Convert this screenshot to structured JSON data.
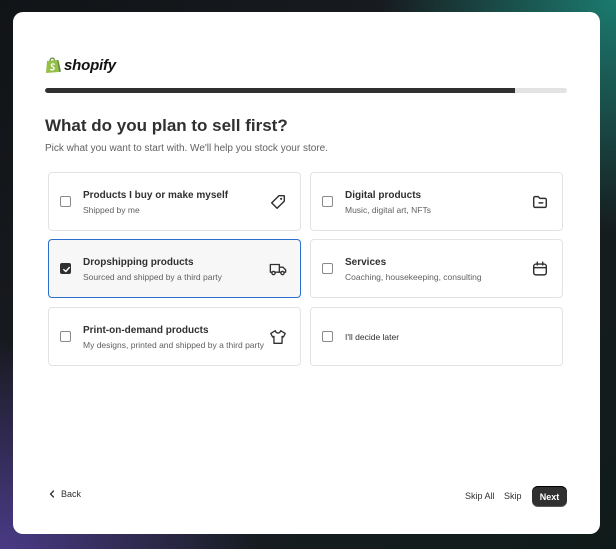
{
  "brand": {
    "name": "shopify",
    "logo_icon": "shopify-bag-icon",
    "accent": "#95bf47"
  },
  "progress": {
    "percent": 90
  },
  "page": {
    "title": "What do you plan to sell first?",
    "subtitle": "Pick what you want to start with. We'll help you stock your store."
  },
  "options": [
    {
      "title": "Products I buy or make myself",
      "subtitle": "Shipped by me",
      "icon": "tag-icon",
      "checked": false
    },
    {
      "title": "Digital products",
      "subtitle": "Music, digital art, NFTs",
      "icon": "folder-icon",
      "checked": false
    },
    {
      "title": "Dropshipping products",
      "subtitle": "Sourced and shipped by a third party",
      "icon": "truck-icon",
      "checked": true
    },
    {
      "title": "Services",
      "subtitle": "Coaching, housekeeping, consulting",
      "icon": "calendar-icon",
      "checked": false
    },
    {
      "title": "Print-on-demand products",
      "subtitle": "My designs, printed and shipped by a third party",
      "icon": "tshirt-icon",
      "checked": false
    },
    {
      "label": "I'll decide later",
      "checked": false
    }
  ],
  "footer": {
    "back_label": "Back",
    "skip_all_label": "Skip All",
    "skip_label": "Skip",
    "next_label": "Next"
  }
}
